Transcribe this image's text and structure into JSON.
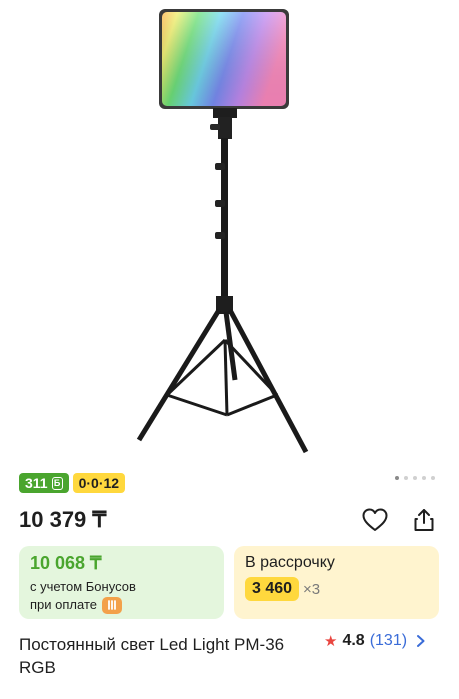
{
  "colors": {
    "bonus_green": "#4aa52e",
    "installment_yellow": "#ffd83d",
    "rating_star": "#e94640",
    "link_blue": "#3a6cd8"
  },
  "gallery": {
    "image_label": "product-photo-led-light-on-tripod",
    "slide_count": 5,
    "active_slide": 1
  },
  "badges": {
    "bonus": "311",
    "installment": "0·0·12"
  },
  "price": "10 379 ₸",
  "actions": {
    "favorite_icon": "heart-icon",
    "share_icon": "share-icon"
  },
  "bonus_card": {
    "price": "10 068 ₸",
    "note_line1": "с учетом Бонусов",
    "note_line2": "при оплате"
  },
  "installment_card": {
    "title": "В рассрочку",
    "amount": "3 460",
    "months": "×3"
  },
  "product": {
    "title": "Постоянный свет Led Light PM-36 RGB",
    "rating": "4.8",
    "reviews": "(131)"
  }
}
